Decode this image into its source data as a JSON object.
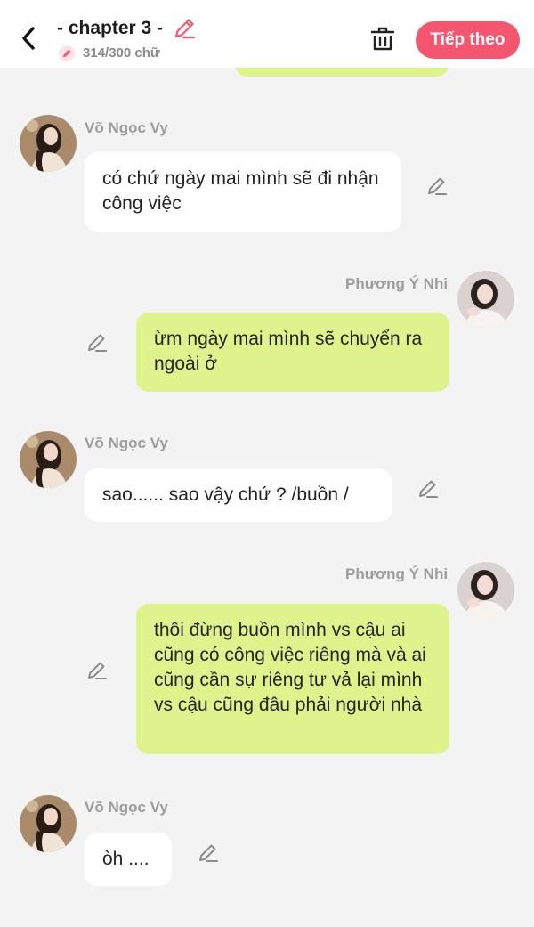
{
  "header": {
    "title": "- chapter 3 -",
    "char_count": "314/300 chữ",
    "next_label": "Tiếp theo"
  },
  "messages": [
    {
      "sender": "Võ Ngọc Vy",
      "side": "left",
      "text": "có chứ ngày mai mình sẽ đi nhận công việc"
    },
    {
      "sender": "Phương Ý Nhi",
      "side": "right",
      "text": "ừm ngày mai mình sẽ chuyển ra ngoài ở"
    },
    {
      "sender": "Võ Ngọc Vy",
      "side": "left",
      "text": "sao...... sao vậy chứ ? /buồn /"
    },
    {
      "sender": "Phương Ý Nhi",
      "side": "right",
      "text": "thôi đừng buồn mình vs cậu ai cũng có công việc riêng mà và ai cũng cần sự riêng tư vả lại mình vs cậu cũng đâu phải người nhà"
    },
    {
      "sender": "Võ Ngọc Vy",
      "side": "left",
      "text": "òh ...."
    }
  ],
  "colors": {
    "accent": "#f4566f",
    "right_bubble": "#dff38d",
    "left_bubble": "#ffffff",
    "background": "#f3f3f3"
  }
}
